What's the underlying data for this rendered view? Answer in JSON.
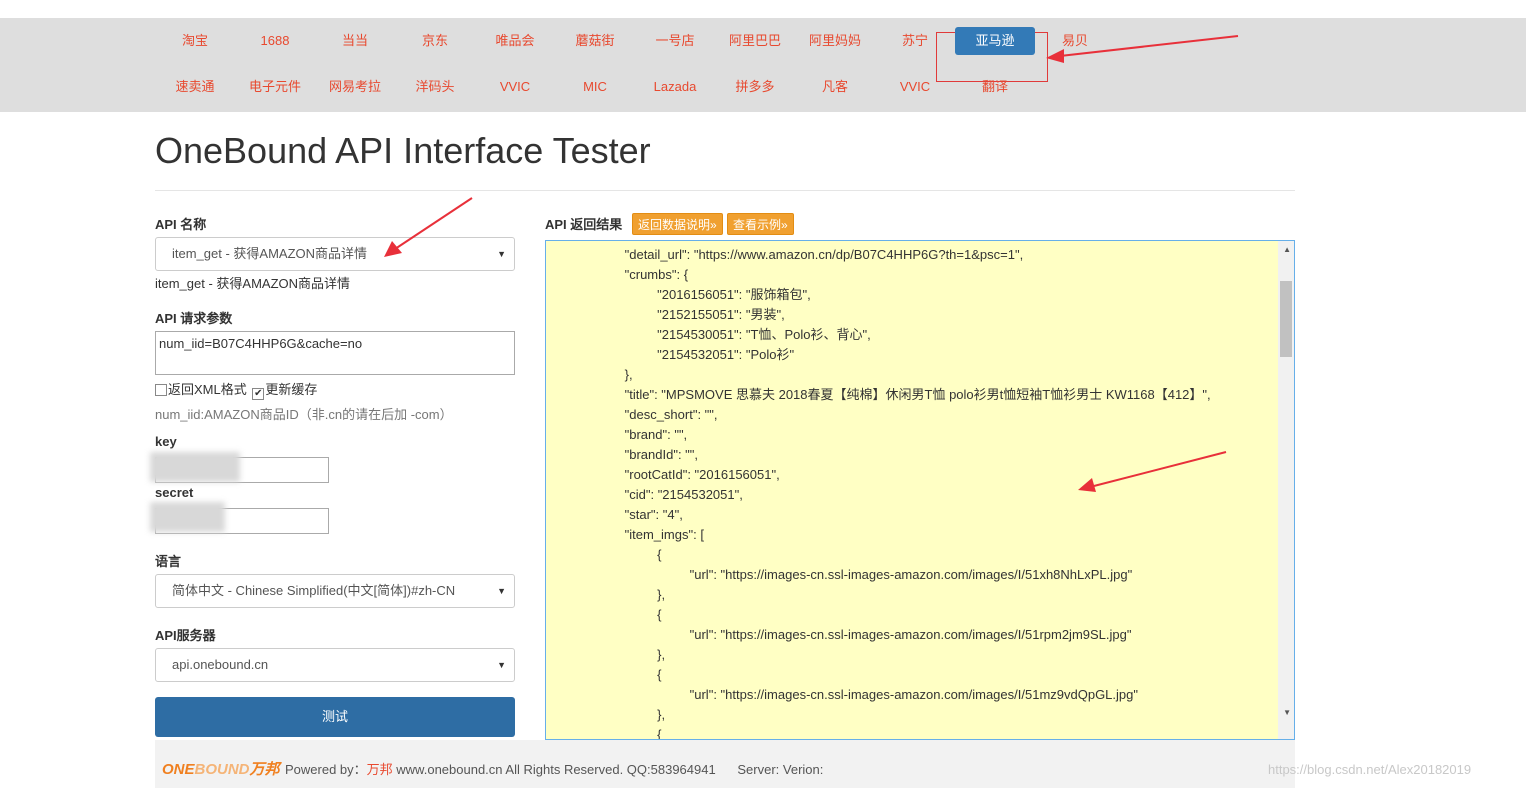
{
  "nav": {
    "row1": [
      "淘宝",
      "1688",
      "当当",
      "京东",
      "唯品会",
      "蘑菇街",
      "一号店",
      "阿里巴巴",
      "阿里妈妈",
      "苏宁",
      "亚马逊",
      "易贝"
    ],
    "row2": [
      "速卖通",
      "电子元件",
      "网易考拉",
      "洋码头",
      "VVIC",
      "MIC",
      "Lazada",
      "拼多多",
      "凡客",
      "VVIC",
      "翻译"
    ],
    "active": "亚马逊"
  },
  "page_title": "OneBound API Interface Tester",
  "form": {
    "api_name_label": "API 名称",
    "api_name_value": "item_get - 获得AMAZON商品详情",
    "api_name_desc": "item_get - 获得AMAZON商品详情",
    "params_label": "API 请求参数",
    "params_value": "num_iid=B07C4HHP6G&cache=no",
    "xml_label": "返回XML格式",
    "cache_label": "更新缓存",
    "params_hint": "num_iid:AMAZON商品ID（非.cn的请在后加 -com）",
    "key_label": "key",
    "secret_label": "secret",
    "lang_label": "语言",
    "lang_value": "简体中文 - Chinese Simplified(中文[简体])#zh-CN",
    "server_label": "API服务器",
    "server_value": "api.onebound.cn",
    "test_button": "测试"
  },
  "result": {
    "label": "API 返回结果",
    "doc_button": "返回数据说明»",
    "example_button": "查看示例»",
    "lines": [
      "                   \"detail_url\": \"https://www.amazon.cn/dp/B07C4HHP6G?th=1&psc=1\",",
      "                   \"crumbs\": {",
      "                            \"2016156051\": \"服饰箱包\",",
      "                            \"2152155051\": \"男装\",",
      "                            \"2154530051\": \"T恤、Polo衫、背心\",",
      "                            \"2154532051\": \"Polo衫\"",
      "                   },",
      "                   \"title\": \"MPSMOVE 思慕夫 2018春夏【纯棉】休闲男T恤 polo衫男t恤短袖T恤衫男士 KW1168【412】\",",
      "                   \"desc_short\": \"\",",
      "                   \"brand\": \"\",",
      "                   \"brandId\": \"\",",
      "                   \"rootCatId\": \"2016156051\",",
      "                   \"cid\": \"2154532051\",",
      "                   \"star\": \"4\",",
      "                   \"item_imgs\": [",
      "                            {",
      "                                     \"url\": \"https://images-cn.ssl-images-amazon.com/images/I/51xh8NhLxPL.jpg\"",
      "                            },",
      "                            {",
      "                                     \"url\": \"https://images-cn.ssl-images-amazon.com/images/I/51rpm2jm9SL.jpg\"",
      "                            },",
      "                            {",
      "                                     \"url\": \"https://images-cn.ssl-images-amazon.com/images/I/51mz9vdQpGL.jpg\"",
      "                            },",
      "                            {"
    ]
  },
  "footer": {
    "logo_text": "ONE",
    "logo_text2": "BOUND",
    "logo_cn": "万邦",
    "powered_by": "Powered by：",
    "brand": "万邦",
    "rest": " www.onebound.cn All Rights Reserved. QQ:583964941      Server: Verion:"
  },
  "watermark": "https://blog.csdn.net/Alex20182019"
}
